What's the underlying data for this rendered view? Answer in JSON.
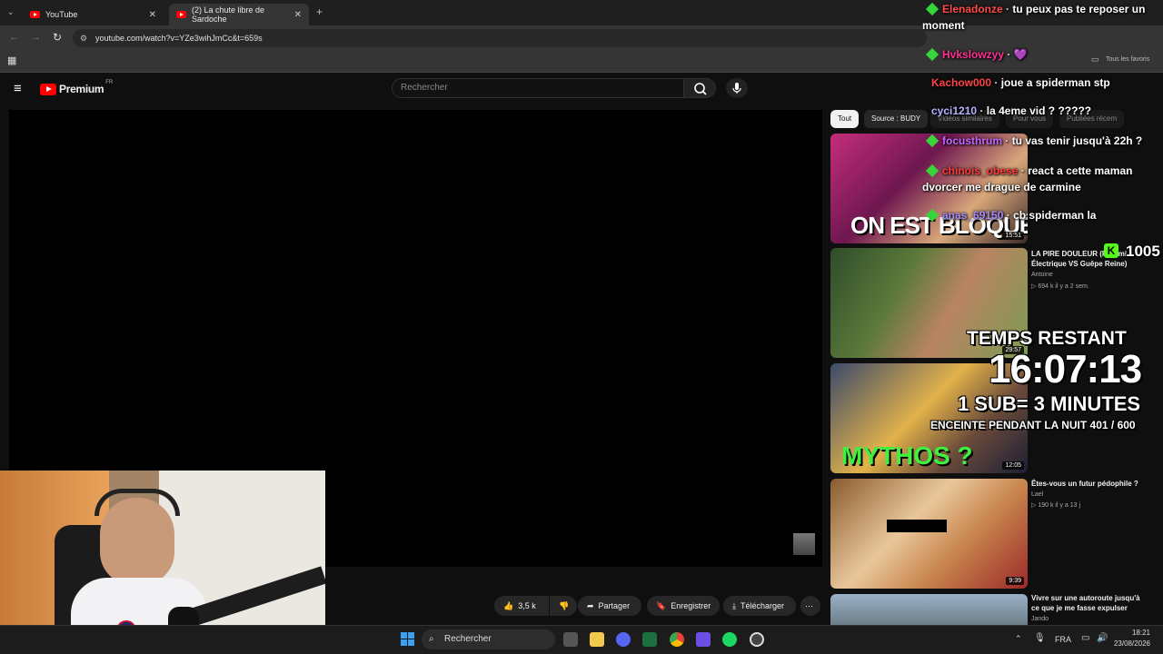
{
  "browser": {
    "tabs": [
      {
        "label": "YouTube"
      },
      {
        "label": "(2) La chute libre de Sardoche"
      }
    ],
    "url": "youtube.com/watch?v=YZe3wihJmCc&t=659s",
    "bookmarks_all": "Tous les favoris"
  },
  "youtube": {
    "logo": "Premium",
    "country": "FR",
    "search_placeholder": "Rechercher"
  },
  "actions": {
    "likes": "3,5 k",
    "share": "Partager",
    "save": "Enregistrer",
    "download": "Télécharger"
  },
  "sidebar": {
    "chips": [
      "Tout",
      "Source : BUDY",
      "Vidéos similaires",
      "Pour vous",
      "Publiées récem"
    ],
    "videos": [
      {
        "thumb_text": "ON EST BLOQUÉS",
        "duration": "15:51",
        "title": "",
        "channel": "",
        "meta": ""
      },
      {
        "thumb_text": "",
        "duration": "29:57",
        "title": "LA PIRE DOULEUR (Fourmi Électrique VS Guêpe Reine)",
        "channel": "Antoine",
        "meta": "▷ 694 k   il y a 2 sem."
      },
      {
        "thumb_text": "MYTHOS ?",
        "duration": "12:05",
        "title": "",
        "channel": "",
        "meta": ""
      },
      {
        "thumb_text": "",
        "duration": "9:39",
        "title": "Êtes-vous un futur pédophile ?",
        "channel": "Lael",
        "meta": "▷ 190 k   il y a 13 j"
      },
      {
        "thumb_text": "",
        "duration": "",
        "title": "Vivre sur une autoroute jusqu'à ce que je me fasse expulser",
        "channel": "Jando",
        "meta": ""
      }
    ]
  },
  "chat": [
    {
      "user": "Elenadonze",
      "color": "#ff4a4a",
      "message": "tu peux pas te reposer un moment"
    },
    {
      "user": "Hvkslowzyy",
      "color": "#ff2f93",
      "message": "💜"
    },
    {
      "user": "Kachow000",
      "color": "#ff4242",
      "message": "joue a spiderman stp"
    },
    {
      "user": "cyci1210",
      "color": "#b5b1ff",
      "message": "la 4eme vid ? ?????"
    },
    {
      "user": "focusthrum",
      "color": "#c566ff",
      "message": "tu vas tenir jusqu'à 22h ?"
    },
    {
      "user": "chinois_obese",
      "color": "#ff3a3a",
      "message": "react a cette maman dvorcer me drague de carmine"
    },
    {
      "user": "anas_69150",
      "color": "#a78bfa",
      "message": "cb spiderman la"
    }
  ],
  "overlay": {
    "viewer_count": "1005",
    "timer_label": "TEMPS RESTANT",
    "timer": "16:07:13",
    "sub_rule": "1 SUB= 3 MINUTES",
    "goal": "ENCEINTE PENDANT LA NUIT 401 / 600"
  },
  "taskbar": {
    "search": "Rechercher",
    "lang": "FRA",
    "time": "18:21",
    "date": "23/08/2026"
  }
}
